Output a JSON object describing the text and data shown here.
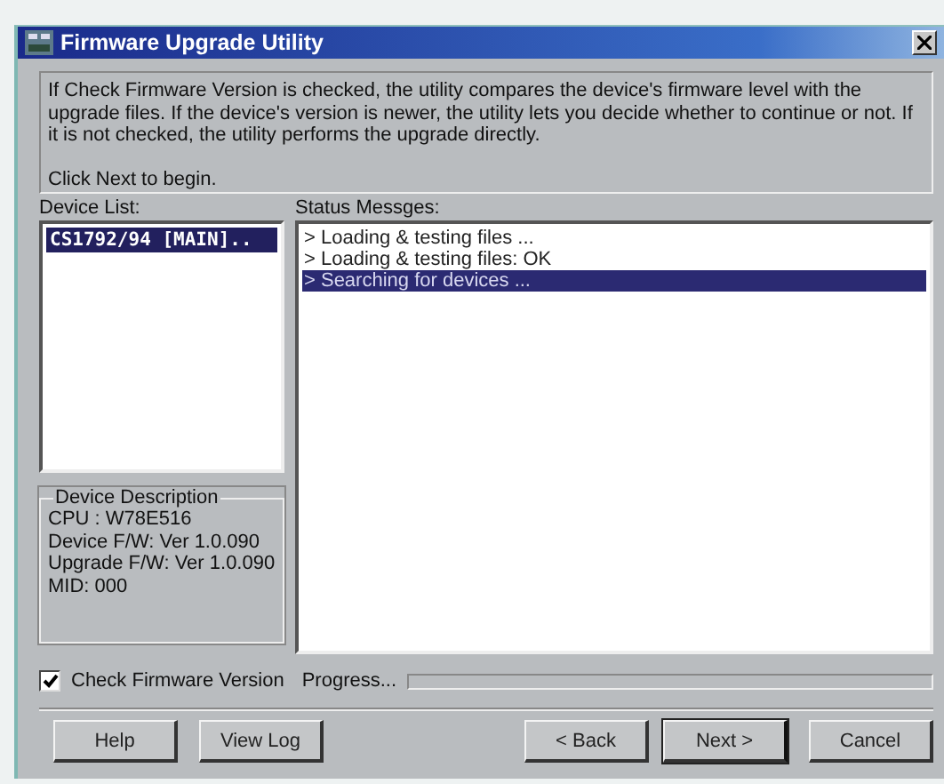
{
  "window": {
    "title": "Firmware Upgrade Utility"
  },
  "intro": {
    "text": "If Check Firmware Version is checked, the utility compares the device's firmware level with the upgrade files. If the device's version is newer, the utility lets you decide whether to continue or not. If it is not checked, the utility performs the upgrade directly.",
    "prompt": "Click Next to begin."
  },
  "device_list": {
    "label": "Device List:",
    "items": [
      {
        "text": "CS1792/94 [MAIN]..",
        "selected": true
      }
    ]
  },
  "device_description": {
    "title": "Device Description",
    "lines": [
      "CPU : W78E516",
      "Device F/W: Ver 1.0.090",
      "Upgrade F/W: Ver 1.0.090",
      "MID: 000"
    ]
  },
  "status_messages": {
    "label": "Status Messges:",
    "items": [
      {
        "text": "> Loading & testing files ...",
        "selected": false
      },
      {
        "text": "> Loading & testing files: OK",
        "selected": false
      },
      {
        "text": "> Searching for devices ...",
        "selected": true
      }
    ]
  },
  "check_firmware": {
    "label": "Check Firmware Version",
    "checked": true
  },
  "progress": {
    "label": "Progress...",
    "level": 0
  },
  "buttons": [
    {
      "label": "Help",
      "default": false
    },
    {
      "label": "View Log",
      "default": false
    },
    {
      "label": "< Back",
      "default": false
    },
    {
      "label": "Next >",
      "default": true
    },
    {
      "label": "Cancel",
      "default": false
    }
  ]
}
